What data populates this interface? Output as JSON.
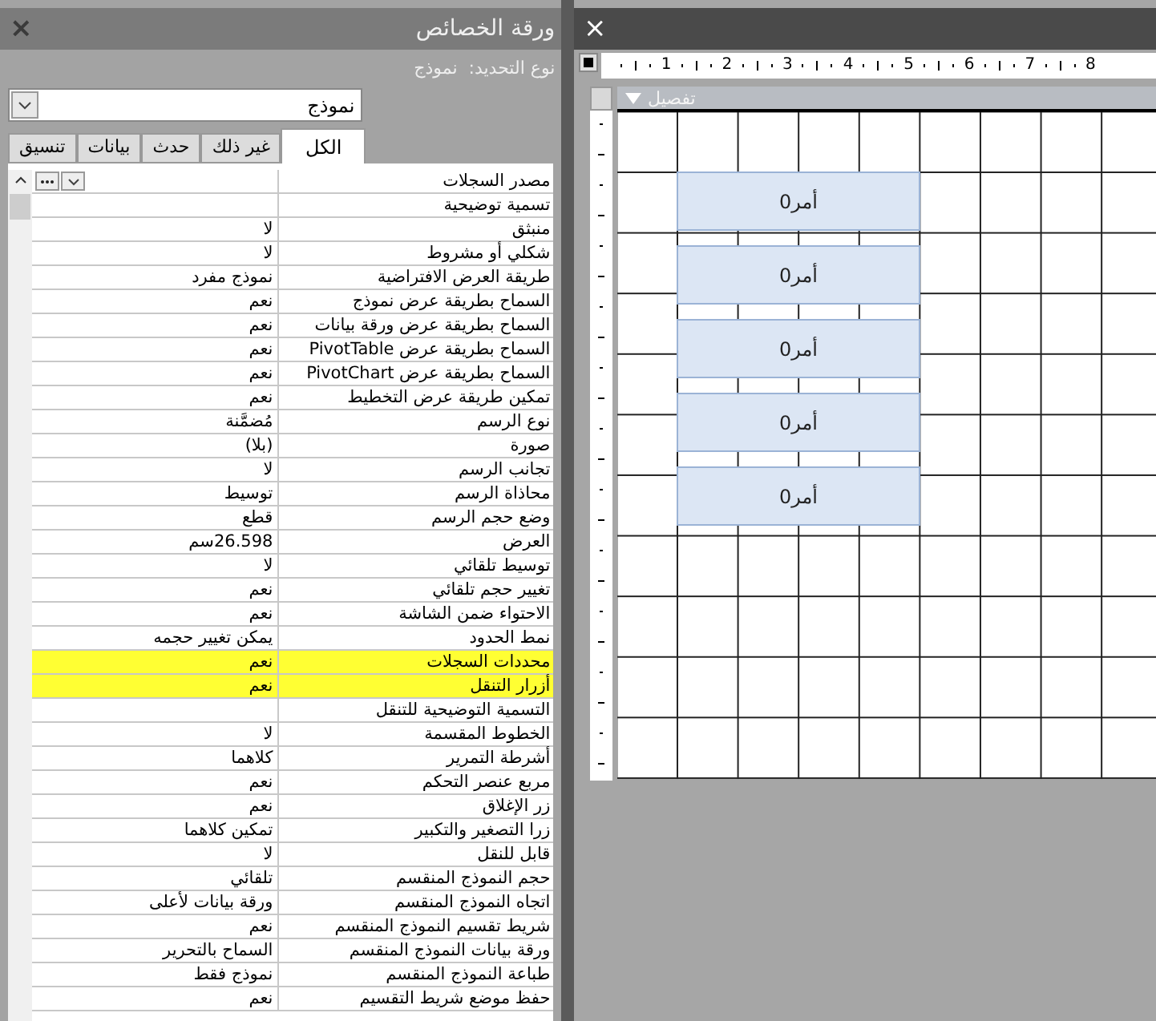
{
  "property_sheet": {
    "title": "ورقة الخصائص",
    "close": "×",
    "selection_type": "نوع التحديد:  نموذج",
    "object_dropdown": {
      "value": "نموذج"
    },
    "tabs": [
      {
        "label": "الكل",
        "selected": true
      },
      {
        "label": "غير ذلك",
        "selected": false
      },
      {
        "label": "حدث",
        "selected": false
      },
      {
        "label": "بيانات",
        "selected": false
      },
      {
        "label": "تنسيق",
        "selected": false
      }
    ],
    "properties": [
      {
        "label": "مصدر السجلات",
        "kind": "builder",
        "highlighted": false
      },
      {
        "label": "تسمية توضيحية",
        "kind": "text",
        "highlighted": false
      },
      {
        "label": "منبثق",
        "value": "لا",
        "kind": "text",
        "highlighted": false
      },
      {
        "label": "شكلي أو مشروط",
        "value": "لا",
        "kind": "text",
        "highlighted": false
      },
      {
        "label": "طريقة العرض الافتراضية",
        "value": "نموذج مفرد",
        "kind": "text",
        "highlighted": false
      },
      {
        "label": "السماح بطريقة عرض نموذج",
        "value": "نعم",
        "kind": "text",
        "highlighted": false
      },
      {
        "label": "السماح بطريقة عرض ورقة بيانات",
        "value": "نعم",
        "kind": "text",
        "highlighted": false
      },
      {
        "label": "السماح بطريقة عرض PivotTable",
        "value": "نعم",
        "kind": "text",
        "highlighted": false
      },
      {
        "label": "السماح بطريقة عرض PivotChart",
        "value": "نعم",
        "kind": "text",
        "highlighted": false
      },
      {
        "label": "تمكين طريقة عرض التخطيط",
        "value": "نعم",
        "kind": "text",
        "highlighted": false
      },
      {
        "label": "نوع الرسم",
        "value": "مُضمَّنة",
        "kind": "text",
        "highlighted": false
      },
      {
        "label": "صورة",
        "value": "(بلا)",
        "kind": "text",
        "highlighted": false
      },
      {
        "label": "تجانب الرسم",
        "value": "لا",
        "kind": "text",
        "highlighted": false
      },
      {
        "label": "محاذاة الرسم",
        "value": "توسيط",
        "kind": "text",
        "highlighted": false
      },
      {
        "label": "وضع حجم الرسم",
        "value": "قطع",
        "kind": "text",
        "highlighted": false
      },
      {
        "label": "العرض",
        "value": "26.598سم",
        "kind": "text",
        "highlighted": false
      },
      {
        "label": "توسيط تلقائي",
        "value": "لا",
        "kind": "text",
        "highlighted": false
      },
      {
        "label": "تغيير حجم تلقائي",
        "value": "نعم",
        "kind": "text",
        "highlighted": false
      },
      {
        "label": "الاحتواء ضمن الشاشة",
        "value": "نعم",
        "kind": "text",
        "highlighted": false
      },
      {
        "label": "نمط الحدود",
        "value": "يمكن تغيير حجمه",
        "kind": "text",
        "highlighted": false
      },
      {
        "label": "محددات السجلات",
        "value": "نعم",
        "kind": "text",
        "highlighted": true
      },
      {
        "label": "أزرار التنقل",
        "value": "نعم",
        "kind": "text",
        "highlighted": true
      },
      {
        "label": "التسمية التوضيحية للتنقل",
        "kind": "text",
        "highlighted": false
      },
      {
        "label": "الخطوط المقسمة",
        "value": "لا",
        "kind": "text",
        "highlighted": false
      },
      {
        "label": "أشرطة التمرير",
        "value": "كلاهما",
        "kind": "text",
        "highlighted": false
      },
      {
        "label": "مربع عنصر التحكم",
        "value": "نعم",
        "kind": "text",
        "highlighted": false
      },
      {
        "label": "زر الإغلاق",
        "value": "نعم",
        "kind": "text",
        "highlighted": false
      },
      {
        "label": "زرا التصغير والتكبير",
        "value": "تمكين كلاهما",
        "kind": "text",
        "highlighted": false
      },
      {
        "label": "قابل للنقل",
        "value": "لا",
        "kind": "text",
        "highlighted": false
      },
      {
        "label": "حجم النموذج المنقسم",
        "value": "تلقائي",
        "kind": "text",
        "highlighted": false
      },
      {
        "label": "اتجاه النموذج المنقسم",
        "value": "ورقة بيانات لأعلى",
        "kind": "text",
        "highlighted": false
      },
      {
        "label": "شريط تقسيم النموذج المنقسم",
        "value": "نعم",
        "kind": "text",
        "highlighted": false
      },
      {
        "label": "ورقة بيانات النموذج المنقسم",
        "value": "السماح بالتحرير",
        "kind": "text",
        "highlighted": false
      },
      {
        "label": "طباعة النموذج المنقسم",
        "value": "نموذج فقط",
        "kind": "text",
        "highlighted": false
      },
      {
        "label": "حفظ موضع شريط التقسيم",
        "value": "نعم",
        "kind": "text",
        "highlighted": false
      }
    ]
  },
  "form_design": {
    "close": "×",
    "ruler_numbers": [
      "8",
      "7",
      "6",
      "5",
      "4",
      "3",
      "2",
      "1"
    ],
    "section": "تفصيل",
    "buttons": [
      {
        "label": "أمر0"
      },
      {
        "label": "أمر0"
      },
      {
        "label": "أمر0"
      },
      {
        "label": "أمر0"
      },
      {
        "label": "أمر0"
      }
    ]
  }
}
